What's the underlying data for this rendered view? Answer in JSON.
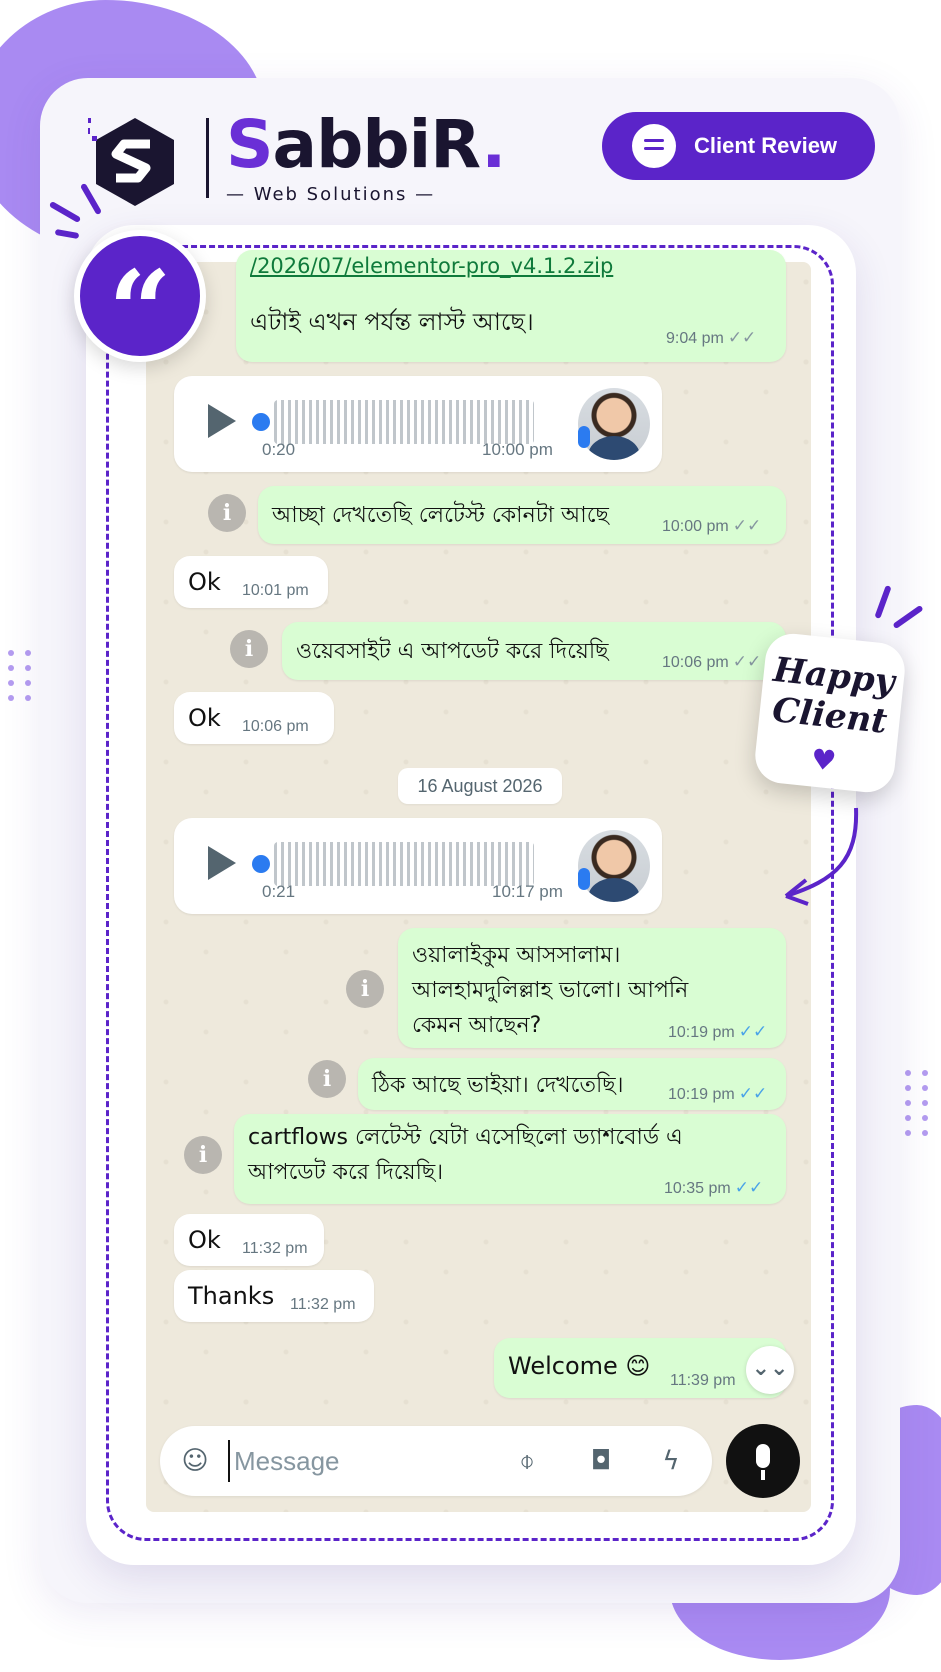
{
  "brand": {
    "name_first": "S",
    "name_rest": "abbiR",
    "name_dot": ".",
    "tagline": "— Web Solutions —"
  },
  "header": {
    "review_button_label": "Client Review",
    "review_icon": "chat-bubble-icon"
  },
  "sticker": {
    "line1": "Happy",
    "line2": "Client",
    "heart": "♥"
  },
  "quote_mark": "“",
  "chat": {
    "messages": [
      {
        "type": "out",
        "link": "/2026/07/elementor-pro_v4.1.2.zip",
        "text": "এটাই এখন পর্যন্ত লাস্ট আছে।",
        "time": "9:04 pm"
      },
      {
        "type": "voice",
        "duration": "0:20",
        "time": "10:00 pm"
      },
      {
        "type": "out",
        "text": "আচ্ছা দেখতেছি লেটেস্ট কোনটা আছে",
        "time": "10:00 pm"
      },
      {
        "type": "in",
        "text": "Ok",
        "time": "10:01 pm"
      },
      {
        "type": "out",
        "text": "ওয়েবসাইট এ আপডেট করে দিয়েছি",
        "time": "10:06 pm"
      },
      {
        "type": "in",
        "text": "Ok",
        "time": "10:06 pm"
      },
      {
        "type": "voice",
        "duration": "0:21",
        "time": "10:17 pm"
      },
      {
        "type": "out",
        "text": "ওয়ালাইকুম আসসালাম। আলহামদুলিল্লাহ ভালো। আপনি কেমন আছেন?",
        "time": "10:19 pm"
      },
      {
        "type": "out",
        "text": "ঠিক আছে ভাইয়া। দেখতেছি।",
        "time": "10:19 pm"
      },
      {
        "type": "out",
        "text": "cartflows লেটেস্ট যেটা এসেছিলো ড্যাশবোর্ড এ আপডেট করে দিয়েছি।",
        "time": "10:35 pm"
      },
      {
        "type": "in",
        "text": "Ok",
        "time": "11:32 pm"
      },
      {
        "type": "in",
        "text": "Thanks",
        "time": "11:32 pm"
      },
      {
        "type": "out",
        "text": "Welcome 😊",
        "time": "11:39 pm"
      }
    ],
    "date_divider": "16 August 2026",
    "info_glyph": "i",
    "tick_double": "✓✓",
    "scroll_down_glyph": "⌄⌄"
  },
  "composer": {
    "placeholder": "Message",
    "icons": [
      "sticker-icon",
      "attach-icon",
      "camera-icon",
      "bolt-icon"
    ],
    "send_icon": "mic-icon"
  },
  "colors": {
    "brand_purple": "#5b24c9",
    "outgoing_bubble": "#d9fdd3",
    "incoming_bubble": "#ffffff",
    "read_tick_blue": "#4aa3e8",
    "delivered_tick_grey": "#8696a0"
  }
}
